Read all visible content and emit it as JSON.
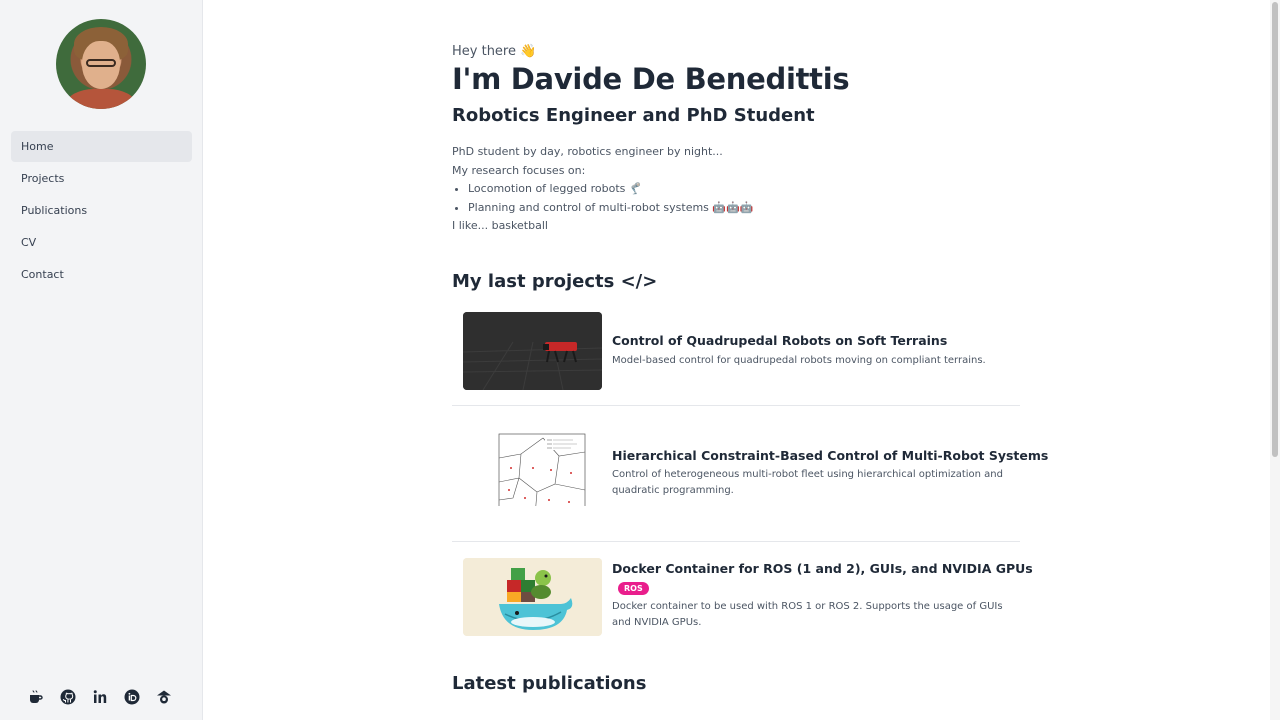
{
  "sidebar": {
    "nav": [
      {
        "label": "Home",
        "active": true
      },
      {
        "label": "Projects",
        "active": false
      },
      {
        "label": "Publications",
        "active": false
      },
      {
        "label": "CV",
        "active": false
      },
      {
        "label": "Contact",
        "active": false
      }
    ],
    "socials": [
      "coffee-icon",
      "github-icon",
      "linkedin-icon",
      "orcid-icon",
      "scholar-icon"
    ]
  },
  "hero": {
    "greeting": "Hey there 👋",
    "name": "I'm Davide De Benedittis",
    "role": "Robotics Engineer and PhD Student",
    "bio_line1": "PhD student by day, robotics engineer by night...",
    "bio_line2": "My research focuses on:",
    "bio_items": [
      "Locomotion of legged robots 🦿",
      "Planning and control of multi-robot systems 🤖🤖🤖"
    ],
    "bio_line3": "I like... basketball"
  },
  "projects_section": {
    "title": "My last projects </>",
    "items": [
      {
        "title": "Control of Quadrupedal Robots on Soft Terrains",
        "description": "Model-based control for quadrupedal robots moving on compliant terrains.",
        "badge": ""
      },
      {
        "title": "Hierarchical Constraint-Based Control of Multi-Robot Systems",
        "description": "Control of heterogeneous multi-robot fleet using hierarchical optimization and quadratic programming.",
        "badge": ""
      },
      {
        "title": "Docker Container for ROS (1 and 2), GUIs, and NVIDIA GPUs",
        "description": "Docker container to be used with ROS 1 or ROS 2. Supports the usage of GUIs and NVIDIA GPUs.",
        "badge": "ROS"
      }
    ]
  },
  "publications_section": {
    "title": "Latest publications"
  },
  "colors": {
    "sidebar_bg": "#f3f4f6",
    "badge": "#e91e8c",
    "heading": "#1f2937"
  }
}
